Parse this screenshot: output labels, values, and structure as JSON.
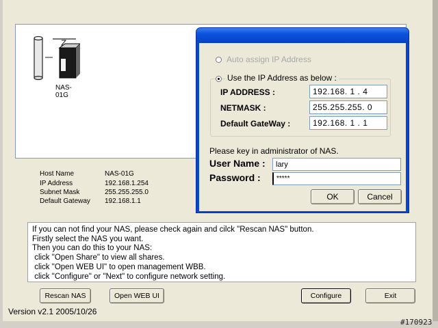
{
  "device": {
    "name": "NAS-01G",
    "host_name_label": "Host Name",
    "host_name": "NAS-01G",
    "ip_label": "IP Address",
    "ip": "192.168.1.254",
    "subnet_label": "Subnet Mask",
    "subnet": "255.255.255.0",
    "gateway_label": "Default Gateway",
    "gateway": "192.168.1.1"
  },
  "instructions": [
    "If you can not find your NAS, please check again and cilck \"Rescan NAS\" button.",
    "Firstly select the NAS you want.",
    "Then you can do this to your NAS:",
    " click \"Open Share\" to view all shares.",
    " click \"Open WEB UI\" to open management WBB.",
    " click \"Configure\" or \"Next\" to configure network setting."
  ],
  "buttons": {
    "rescan": "Rescan NAS",
    "open_web_ui": "Open WEB UI",
    "configure": "Configure",
    "exit": "Exit"
  },
  "version": "Version v2.1 2005/10/26",
  "stamp": "#170923",
  "dialog": {
    "auto_assign_label": "Auto assign IP Address",
    "use_ip_label": "Use the IP Address as below :",
    "ip_label": "IP ADDRESS :",
    "ip_value": "192.168. 1 . 4",
    "netmask_label": "NETMASK :",
    "netmask_value": "255.255.255. 0",
    "gateway_label": "Default GateWay :",
    "gateway_value": "192.168. 1 . 1",
    "admin_prompt": "Please key in administrator of NAS.",
    "username_label": "User Name :",
    "username_value": "lary",
    "password_label": "Password :",
    "password_value": "*****",
    "ok_label": "OK",
    "cancel_label": "Cancel"
  }
}
